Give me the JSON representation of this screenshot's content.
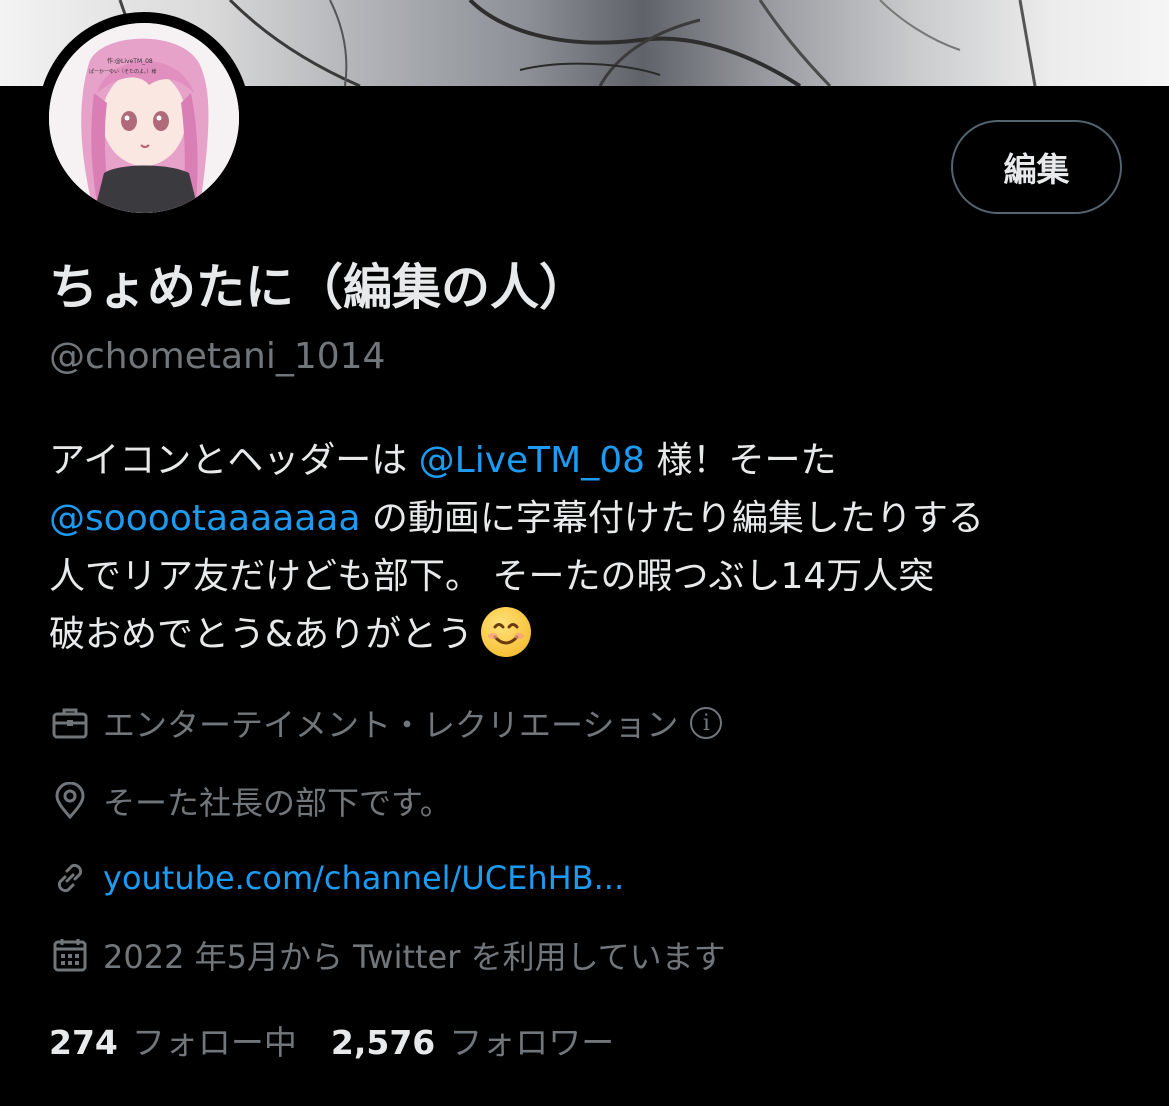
{
  "profile": {
    "display_name": "ちょめたに（編集の人）",
    "handle": "@chometani_1014",
    "edit_label": "編集",
    "avatar_text": "作:@LiveTM_08\nぱーかーゆい（そたのよ。）様"
  },
  "bio": {
    "line1_a": "アイコンとヘッダーは ",
    "line1_mention": "@LiveTM_08",
    "line1_b": " 様！そーた",
    "line2_mention": "@sooootaaaaaaa",
    "line2_b": " の動画に字幕付けたり編集したりする",
    "line3": "人でリア友だけども部下。 そーたの暇つぶし14万人突",
    "line4": "破おめでとう&ありがとう",
    "emoji": "smiling-face-emoji"
  },
  "meta": {
    "category": "エンターテイメント・レクリエーション",
    "location": "そーた社長の部下です。",
    "link": "youtube.com/channel/UCEhHB...",
    "joined": "2022 年5月から Twitter を利用しています"
  },
  "stats": {
    "following_count": "274",
    "following_label": "フォロー中",
    "followers_count": "2,576",
    "followers_label": "フォロワー"
  },
  "colors": {
    "background": "#000000",
    "text": "#e7e9ea",
    "muted": "#71767b",
    "accent": "#1d9bf0",
    "button_border": "#536471"
  },
  "icons": {
    "category": "briefcase-icon",
    "location": "location-pin-icon",
    "link": "link-icon",
    "joined": "calendar-icon",
    "info": "info-icon"
  }
}
